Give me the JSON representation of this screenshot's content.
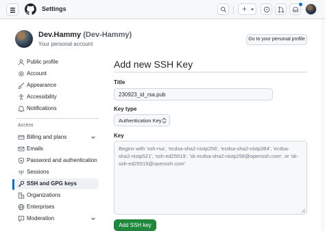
{
  "header": {
    "title": "Settings",
    "plus_label": "+"
  },
  "profile": {
    "name": "Dev.Hammy",
    "handle": "(Dev-Hammy)",
    "subtitle": "Your personal account",
    "goto_button": "Go to your personal profile"
  },
  "sidebar": {
    "items": [
      {
        "label": "Public profile",
        "icon": "person-icon"
      },
      {
        "label": "Account",
        "icon": "gear-icon"
      },
      {
        "label": "Appearance",
        "icon": "paintbrush-icon"
      },
      {
        "label": "Accessibility",
        "icon": "accessibility-icon"
      },
      {
        "label": "Notifications",
        "icon": "bell-icon"
      }
    ],
    "access_heading": "Access",
    "access_items": [
      {
        "label": "Billing and plans",
        "icon": "credit-card-icon"
      },
      {
        "label": "Emails",
        "icon": "mail-icon"
      },
      {
        "label": "Password and authentication",
        "icon": "shield-lock-icon"
      },
      {
        "label": "Sessions",
        "icon": "broadcast-icon"
      },
      {
        "label": "SSH and GPG keys",
        "icon": "key-icon"
      },
      {
        "label": "Organizations",
        "icon": "organization-icon"
      },
      {
        "label": "Enterprises",
        "icon": "globe-icon"
      },
      {
        "label": "Moderation",
        "icon": "report-icon"
      }
    ]
  },
  "form": {
    "heading": "Add new SSH Key",
    "title_label": "Title",
    "title_value": "230923_id_rsa.pub",
    "keytype_label": "Key type",
    "keytype_value": "Authentication Key",
    "key_label": "Key",
    "key_placeholder": "Begins with 'ssh-rsa', 'ecdsa-sha2-nistp256', 'ecdsa-sha2-nistp384', 'ecdsa-sha2-nistp521', 'ssh-ed25519', 'sk-ecdsa-sha2-nistp256@openssh.com', or 'sk-ssh-ed25519@openssh.com'",
    "submit_label": "Add SSH key"
  },
  "colors": {
    "accent": "#0969da",
    "primary_button": "#1f883d",
    "border": "#d0d7de"
  }
}
